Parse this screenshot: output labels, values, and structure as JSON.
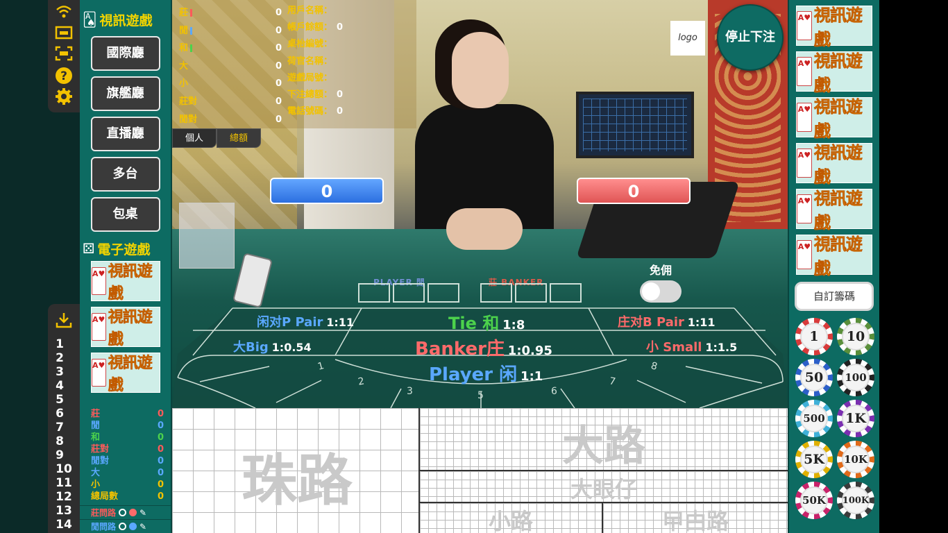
{
  "left_menu": {
    "video_title": "視訊遊戲",
    "halls": [
      "國際廳",
      "旗艦廳",
      "直播廳",
      "多台",
      "包桌"
    ],
    "electronic_title": "電子遊戲",
    "tile_text": "視訊遊戲",
    "tile_card_text": "A♥"
  },
  "icon_strip": {
    "icons": [
      "wifi-icon",
      "fullscreen-window-icon",
      "expand-icon",
      "help-icon",
      "settings-icon"
    ],
    "download_icon": "download-icon",
    "numbers": [
      "1",
      "2",
      "3",
      "4",
      "5",
      "6",
      "7",
      "8",
      "9",
      "10",
      "11",
      "12",
      "13",
      "14"
    ]
  },
  "stats": {
    "rows": [
      {
        "label": "莊",
        "value": "0",
        "color": "#ff5a5a"
      },
      {
        "label": "閒",
        "value": "0",
        "color": "#5aa8ff"
      },
      {
        "label": "和",
        "value": "0",
        "color": "#4cd24c"
      },
      {
        "label": "莊對",
        "value": "0",
        "color": "#ff5a5a"
      },
      {
        "label": "閒對",
        "value": "0",
        "color": "#5aa8ff"
      },
      {
        "label": "大",
        "value": "0",
        "color": "#5aa8ff"
      },
      {
        "label": "小",
        "value": "0",
        "color": "#f2c200"
      },
      {
        "label": "總局數",
        "value": "0",
        "color": "#f2c200"
      }
    ],
    "banker_ask": "莊問路",
    "player_ask": "閒問路"
  },
  "overlay": {
    "left": [
      {
        "label": "莊",
        "value": "0",
        "bar": "#ff5a5a"
      },
      {
        "label": "閒",
        "value": "0",
        "bar": "#5aa8ff"
      },
      {
        "label": "和",
        "value": "0",
        "bar": "#4cd24c"
      },
      {
        "label": "大",
        "value": "0",
        "bar": ""
      },
      {
        "label": "小",
        "value": "0",
        "bar": ""
      },
      {
        "label": "莊對",
        "value": "0",
        "bar": ""
      },
      {
        "label": "閒對",
        "value": "0",
        "bar": ""
      }
    ],
    "right": [
      {
        "label": "用戶名稱：",
        "value": ""
      },
      {
        "label": "帳戶餘額：",
        "value": "0"
      },
      {
        "label": "桌枱編號：",
        "value": ""
      },
      {
        "label": "荷官名稱：",
        "value": ""
      },
      {
        "label": "遊戲局號：",
        "value": ""
      },
      {
        "label": "下注總額：",
        "value": "0"
      },
      {
        "label": "電話號碼：",
        "value": "0"
      }
    ],
    "tabs": [
      "個人",
      "總額"
    ]
  },
  "video": {
    "player_score": "0",
    "banker_score": "0",
    "commission_label": "免佣",
    "logo": "logo",
    "stop_bet": "停止下注",
    "felt_player": "PLAYER 閒",
    "felt_banker": "莊 BANKER"
  },
  "bets": {
    "player_pair": {
      "name": "闲对P Pair",
      "odds": "1:11"
    },
    "tie": {
      "name": "Tie 和",
      "odds": "1:8"
    },
    "banker_pair": {
      "name": "庄对B Pair",
      "odds": "1:11"
    },
    "big": {
      "name": "大Big",
      "odds": "1:0.54"
    },
    "banker": {
      "name": "Banker庄",
      "odds": "1:0.95"
    },
    "small": {
      "name": "小 Small",
      "odds": "1:1.5"
    },
    "player": {
      "name": "Player 闲",
      "odds": "1:1"
    },
    "seat_numbers": [
      "1",
      "2",
      "3",
      "5",
      "6",
      "7",
      "8"
    ]
  },
  "roads": {
    "bead": "珠路",
    "big": "大路",
    "big_eye": "大眼仔",
    "small": "小路",
    "cockroach": "曱甴路"
  },
  "right_panel": {
    "tile_text": "視訊遊戲",
    "tile_count": 6,
    "custom_chip": "自訂籌碼",
    "chips": [
      {
        "label": "1",
        "ring": "#d83b3b"
      },
      {
        "label": "10",
        "ring": "#5a8f3b"
      },
      {
        "label": "50",
        "ring": "#2c5fc9"
      },
      {
        "label": "100",
        "ring": "#222222"
      },
      {
        "label": "500",
        "ring": "#3fb0d8"
      },
      {
        "label": "1K",
        "ring": "#7a2fb0"
      },
      {
        "label": "5K",
        "ring": "#e0b000"
      },
      {
        "label": "10K",
        "ring": "#e06a1a"
      },
      {
        "label": "50K",
        "ring": "#c8236a"
      },
      {
        "label": "100K",
        "ring": "#3b3b3b"
      }
    ]
  }
}
